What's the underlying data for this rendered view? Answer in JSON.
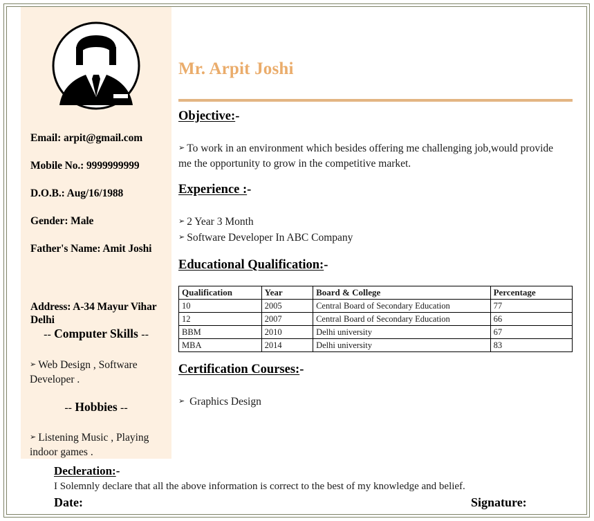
{
  "document": {
    "type": "resume",
    "accent_color": "#eaac6b",
    "rule_color": "#e3b583",
    "sidebar_background": "#fdf0e1",
    "frame_color": "#7d8267",
    "bullet_glyph": "➢"
  },
  "sidebar": {
    "avatar": {
      "icon": "person-silhouette-avatar",
      "description": "circular male silhouette in suit and tie"
    },
    "fields": [
      {
        "label": "Email:",
        "value": "arpit@gmail.com",
        "text": "Email: arpit@gmail.com"
      },
      {
        "label": "Mobile No.:",
        "value": "9999999999",
        "text": "Mobile No.: 9999999999"
      },
      {
        "label": "D.O.B.:",
        "value": "Aug/16/1988",
        "text": "D.O.B.: Aug/16/1988"
      },
      {
        "label": "Gender:",
        "value": "Male",
        "text": "Gender: Male"
      },
      {
        "label": "Father's Name:",
        "value": "Amit Joshi",
        "text": "Father's Name: Amit Joshi"
      },
      {
        "label": "Address:",
        "value": "A-34 Mayur Vihar Delhi",
        "text": "Address: A-34 Mayur Vihar Delhi"
      }
    ],
    "skills_section": {
      "dash_left": "--",
      "title": "Computer Skills",
      "dash_right": "--",
      "items": [
        "Web Design , Software Developer ."
      ]
    },
    "hobbies_section": {
      "dash_left": "--",
      "title": "Hobbies",
      "dash_right": "--",
      "items": [
        "Listening Music , Playing indoor games ."
      ]
    }
  },
  "main": {
    "name": "Mr. Arpit Joshi",
    "objective": {
      "heading": "Objective:",
      "heading_suffix": "-",
      "items": [
        "To work in an environment which besides offering me challenging job,would provide me the opportunity to grow in the competitive market."
      ]
    },
    "experience": {
      "heading": "Experience :",
      "heading_suffix": "-",
      "items": [
        "2 Year 3 Month",
        "Software Developer In ABC Company"
      ]
    },
    "education": {
      "heading": "Educational Qualification:",
      "heading_suffix": "-",
      "columns": [
        "Qualification",
        "Year",
        "Board & College",
        "Percentage"
      ],
      "rows": [
        [
          "10",
          "2005",
          "Central Board of Secondary Education",
          "77"
        ],
        [
          "12",
          "2007",
          "Central Board of Secondary Education",
          "66"
        ],
        [
          "BBM",
          "2010",
          "Delhi university",
          "67"
        ],
        [
          "MBA",
          "2014",
          "Delhi university",
          "83"
        ]
      ]
    },
    "certification": {
      "heading": "Certification Courses:",
      "heading_suffix": "-",
      "items": [
        "Graphics Design"
      ]
    }
  },
  "declaration": {
    "heading": "Decleration:",
    "heading_suffix": "-",
    "text": "I Solemnly declare that all the above information is correct to the best of my knowledge and belief.",
    "date_label": "Date:",
    "signature_label": "Signature:"
  }
}
